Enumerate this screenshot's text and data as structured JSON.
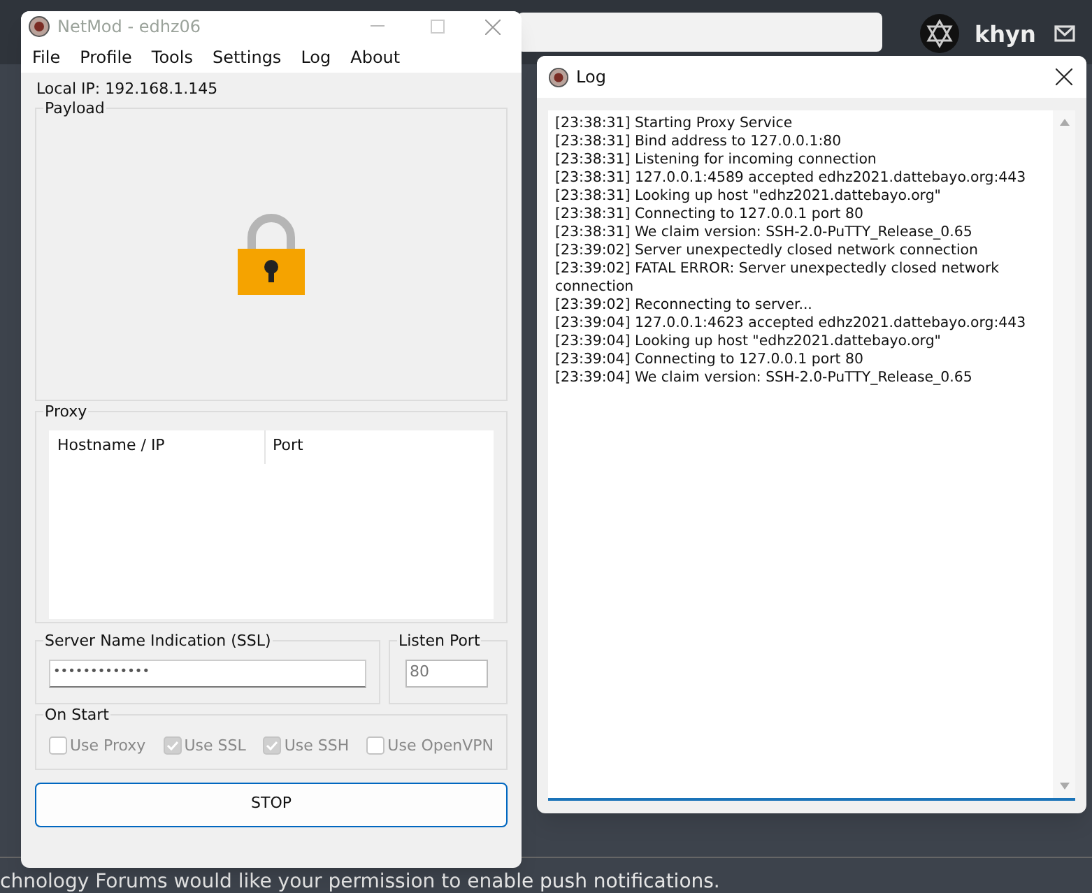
{
  "background": {
    "user_name": "khyn",
    "notification": "chnology Forums would like your permission to enable push notifications."
  },
  "main_window": {
    "title": "NetMod - edhz06",
    "menu": [
      "File",
      "Profile",
      "Tools",
      "Settings",
      "Log",
      "About"
    ],
    "local_ip": "Local IP: 192.168.1.145",
    "payload": {
      "label": "Payload"
    },
    "proxy": {
      "label": "Proxy",
      "columns": [
        "Hostname / IP",
        "Port"
      ]
    },
    "sni": {
      "label": "Server Name Indication (SSL)",
      "value": "•••••••••••••"
    },
    "listen_port": {
      "label": "Listen Port",
      "value": "80"
    },
    "on_start": {
      "label": "On Start",
      "options": [
        {
          "label": "Use Proxy",
          "checked": false,
          "disabled": true
        },
        {
          "label": "Use SSL",
          "checked": true,
          "disabled": true
        },
        {
          "label": "Use SSH",
          "checked": true,
          "disabled": true
        },
        {
          "label": "Use OpenVPN",
          "checked": false,
          "disabled": true
        }
      ]
    },
    "button": "STOP"
  },
  "log_window": {
    "title": "Log",
    "lines": [
      "[23:38:31] Starting Proxy Service",
      "[23:38:31] Bind address to 127.0.0.1:80",
      "[23:38:31] Listening for incoming connection",
      "[23:38:31] 127.0.0.1:4589 accepted edhz2021.dattebayo.org:443",
      "[23:38:31] Looking up host \"edhz2021.dattebayo.org\"",
      "[23:38:31] Connecting to 127.0.0.1 port 80",
      "[23:38:31] We claim version: SSH-2.0-PuTTY_Release_0.65",
      "[23:39:02] Server unexpectedly closed network connection",
      "[23:39:02] FATAL ERROR: Server unexpectedly closed network connection",
      "[23:39:02] Reconnecting to server...",
      "[23:39:04] 127.0.0.1:4623 accepted edhz2021.dattebayo.org:443",
      "[23:39:04] Looking up host \"edhz2021.dattebayo.org\"",
      "[23:39:04] Connecting to 127.0.0.1 port 80",
      "[23:39:04] We claim version: SSH-2.0-PuTTY_Release_0.65"
    ]
  }
}
